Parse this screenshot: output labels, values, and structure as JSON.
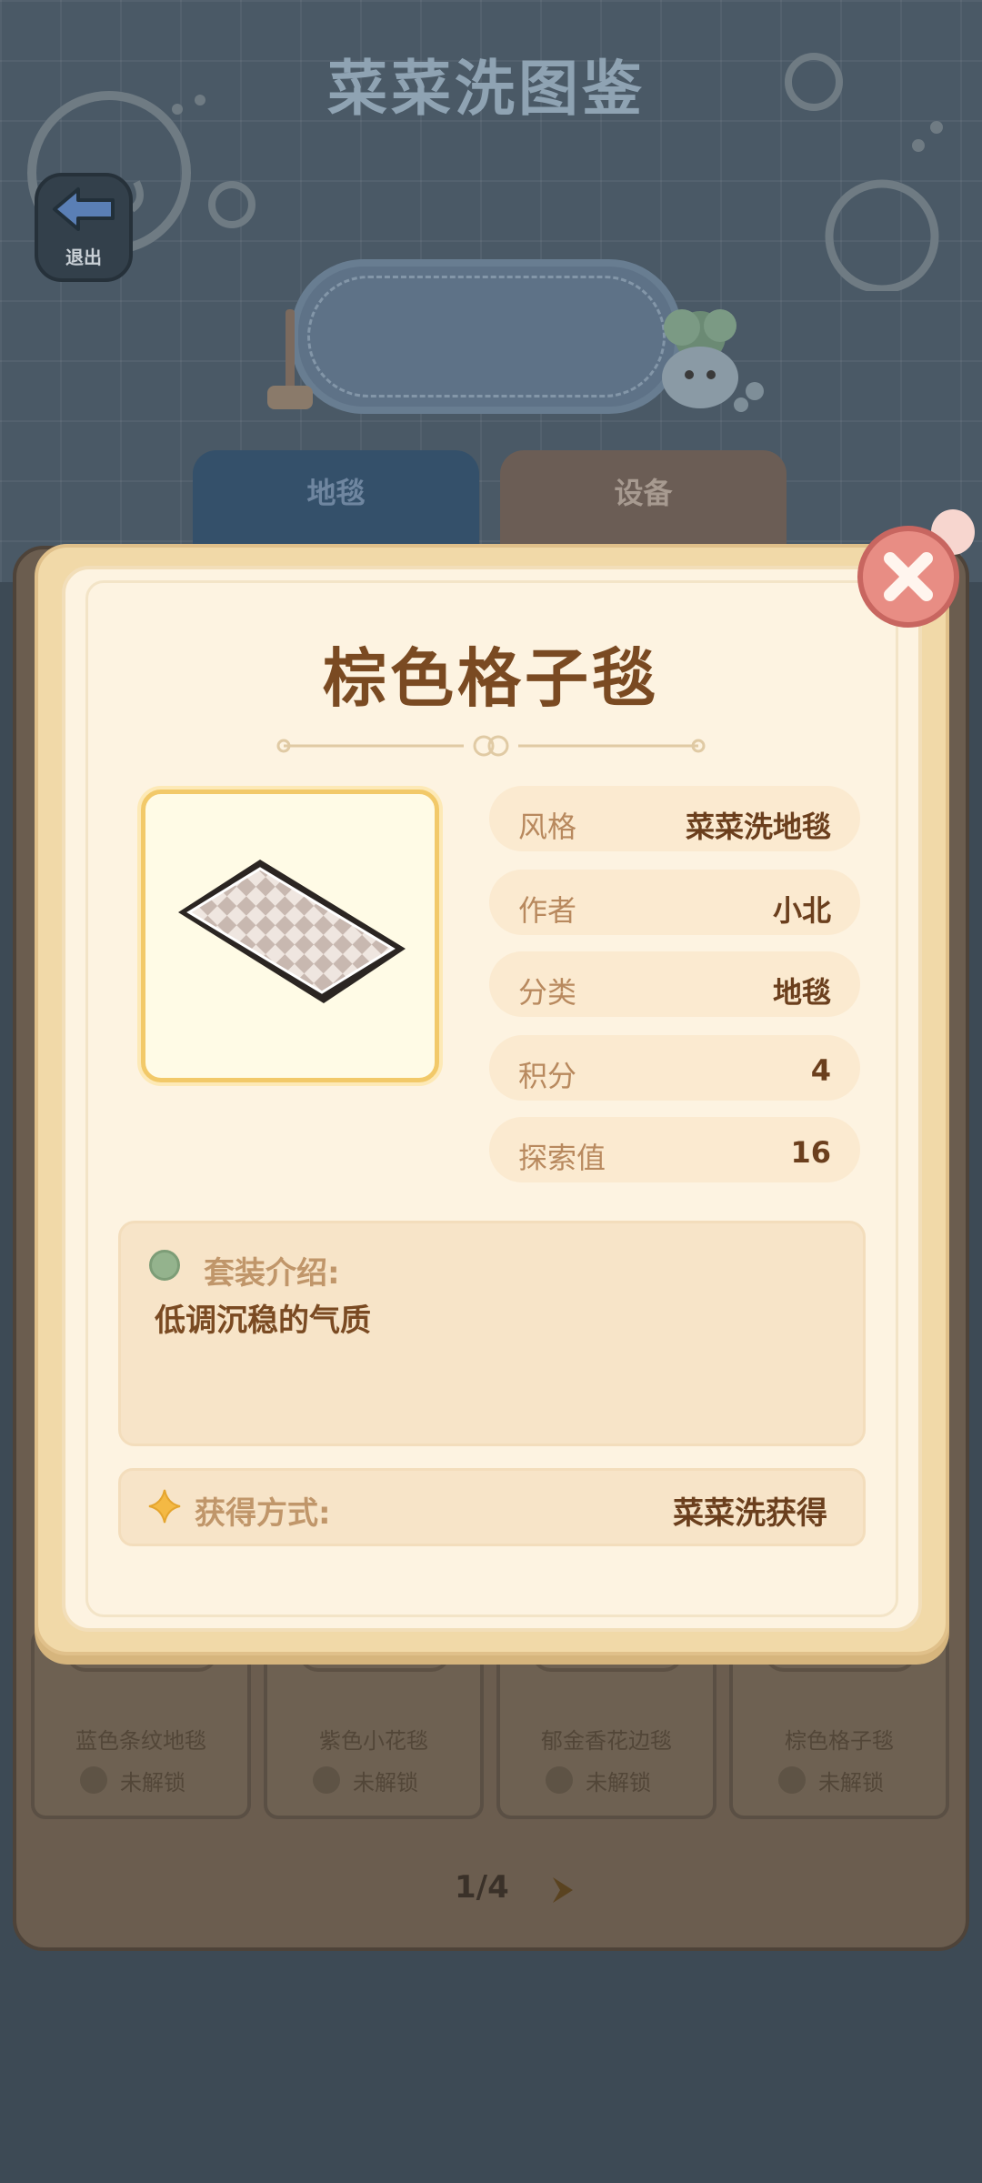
{
  "header": {
    "exit_label": "退出",
    "title": "菜菜洗图鉴"
  },
  "tabs": [
    {
      "label": "地毯"
    },
    {
      "label": "设备"
    }
  ],
  "modal": {
    "title": "棕色格子毯",
    "stats": [
      {
        "key": "风格",
        "value": "菜菜洗地毯"
      },
      {
        "key": "作者",
        "value": "小北"
      },
      {
        "key": "分类",
        "value": "地毯"
      },
      {
        "key": "积分",
        "value": "4"
      },
      {
        "key": "探索值",
        "value": "16"
      }
    ],
    "description_label": "套装介绍:",
    "description": "低调沉稳的气质",
    "acquisition_label": "获得方式:",
    "acquisition_value": "菜菜洗获得"
  },
  "grid": {
    "items": [
      {
        "name": "蓝色条纹地毯",
        "status": "未解锁"
      },
      {
        "name": "紫色小花毯",
        "status": "未解锁"
      },
      {
        "name": "郁金香花边毯",
        "status": "未解锁"
      },
      {
        "name": "棕色格子毯",
        "status": "未解锁"
      }
    ],
    "pager": "1/4"
  }
}
